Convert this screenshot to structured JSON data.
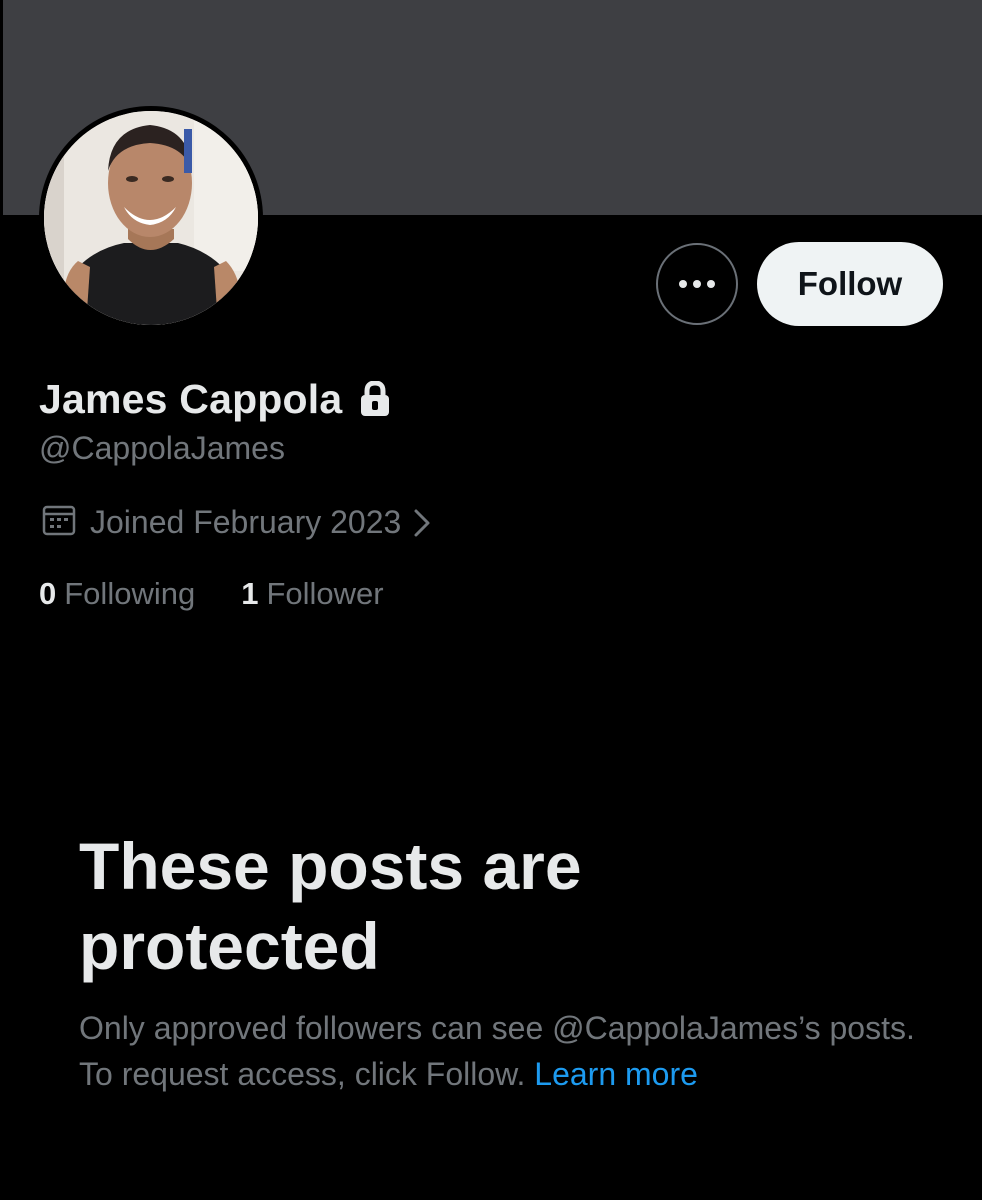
{
  "profile": {
    "display_name": "James Cappola",
    "handle": "@CappolaJames",
    "joined": "Joined February 2023",
    "avatar_alt": "profile-photo"
  },
  "actions": {
    "more_label": "•••",
    "follow_label": "Follow"
  },
  "stats": {
    "following_count": "0",
    "following_label": "Following",
    "followers_count": "1",
    "followers_label": "Follower"
  },
  "protected": {
    "title": "These posts are protected",
    "body": "Only approved followers can see @CappolaJames’s posts. To request access, click Follow.",
    "learn_more": "Learn more"
  },
  "colors": {
    "background": "#000000",
    "banner": "#3e3f43",
    "primary_text": "#e7e9ea",
    "secondary_text": "#71767b",
    "link": "#1d9bf0",
    "follow_button_bg": "#eff3f4"
  },
  "icons": [
    "lock-icon",
    "calendar-icon",
    "chevron-right-icon",
    "more-icon"
  ]
}
